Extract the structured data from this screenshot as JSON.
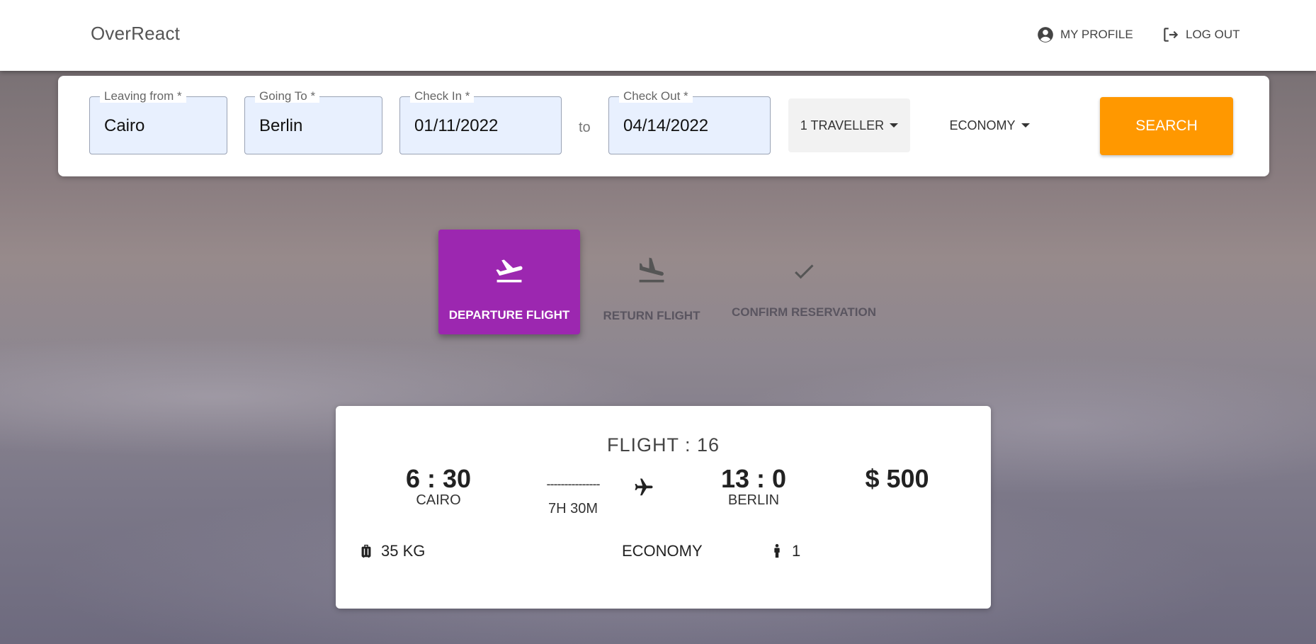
{
  "app": {
    "brand": "OverReact"
  },
  "header": {
    "profile_label": "MY PROFILE",
    "logout_label": "LOG OUT"
  },
  "search": {
    "leaving_from": {
      "label": "Leaving from *",
      "value": "Cairo"
    },
    "going_to": {
      "label": "Going To *",
      "value": "Berlin"
    },
    "check_in": {
      "label": "Check In *",
      "value": "01/11/2022"
    },
    "to_separator": "to",
    "check_out": {
      "label": "Check Out *",
      "value": "04/14/2022"
    },
    "travellers": "1 TRAVELLER",
    "cabin_class": "ECONOMY",
    "search_label": "SEARCH"
  },
  "steps": [
    {
      "label": "DEPARTURE FLIGHT",
      "icon": "flight-takeoff-icon",
      "active": true
    },
    {
      "label": "RETURN FLIGHT",
      "icon": "flight-land-icon",
      "active": false
    },
    {
      "label": "CONFIRM RESERVATION",
      "icon": "check-icon",
      "active": false
    }
  ],
  "flight": {
    "title": "FLIGHT : 16",
    "departure_time": "6 : 30",
    "departure_city": "CAIRO",
    "route_dashes": "---------------",
    "duration": "7H 30M",
    "arrival_time": "13 : 0",
    "arrival_city": "BERLIN",
    "price": "$ 500",
    "baggage": "35 KG",
    "cabin": "ECONOMY",
    "passengers": "1"
  },
  "colors": {
    "accent_purple": "#9c27b0",
    "search_orange": "#ff9800",
    "input_fill": "#e8f0fe"
  }
}
